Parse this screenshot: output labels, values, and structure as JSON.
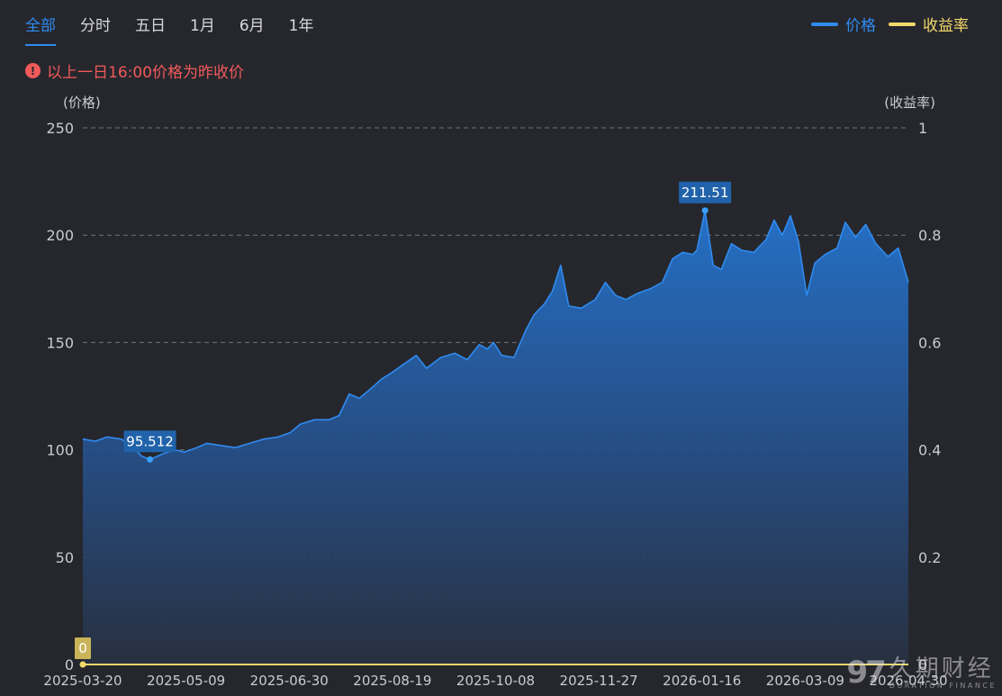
{
  "tabs": [
    {
      "label": "全部",
      "active": true
    },
    {
      "label": "分时",
      "active": false
    },
    {
      "label": "五日",
      "active": false
    },
    {
      "label": "1月",
      "active": false
    },
    {
      "label": "6月",
      "active": false
    },
    {
      "label": "1年",
      "active": false
    }
  ],
  "legend": [
    {
      "label": "价格",
      "color": "#2f8bf0"
    },
    {
      "label": "收益率",
      "color": "#f2d96b"
    }
  ],
  "notice": {
    "icon": "info-icon",
    "text": "以上一日16:00价格为昨收价"
  },
  "watermark": {
    "logo": "97",
    "cn": "久期财经",
    "en": "DURATION FINANCE"
  },
  "chart_data": {
    "type": "area",
    "left_axis_label": "(价格)",
    "right_axis_label": "(收益率)",
    "ylim_left": [
      0,
      250
    ],
    "ylim_right": [
      0,
      1
    ],
    "yticks_left": [
      0,
      50,
      100,
      150,
      200,
      250
    ],
    "yticks_right": [
      "0",
      "0.2",
      "0.4",
      "0.6",
      "0.8",
      "1"
    ],
    "grid": true,
    "x_range": [
      "2025-03-20",
      "2026-04-30"
    ],
    "x_tick_labels": [
      "2025-03-20",
      "2025-05-09",
      "2025-06-30",
      "2025-08-19",
      "2025-10-08",
      "2025-11-27",
      "2026-01-16",
      "2026-03-09",
      "2026-04-30"
    ],
    "series": [
      {
        "name": "价格",
        "axis": "left",
        "color": "#2f8bf0",
        "points": [
          [
            "2025-03-20",
            105
          ],
          [
            "2025-03-26",
            104
          ],
          [
            "2025-04-01",
            106
          ],
          [
            "2025-04-08",
            105
          ],
          [
            "2025-04-14",
            101
          ],
          [
            "2025-04-18",
            97
          ],
          [
            "2025-04-22",
            95.512
          ],
          [
            "2025-04-28",
            98
          ],
          [
            "2025-05-04",
            100
          ],
          [
            "2025-05-09",
            99
          ],
          [
            "2025-05-15",
            101
          ],
          [
            "2025-05-20",
            103
          ],
          [
            "2025-05-27",
            102
          ],
          [
            "2025-06-03",
            101
          ],
          [
            "2025-06-10",
            103
          ],
          [
            "2025-06-17",
            105
          ],
          [
            "2025-06-24",
            106
          ],
          [
            "2025-06-30",
            108
          ],
          [
            "2025-07-05",
            112
          ],
          [
            "2025-07-12",
            114
          ],
          [
            "2025-07-19",
            114
          ],
          [
            "2025-07-24",
            116
          ],
          [
            "2025-07-29",
            126
          ],
          [
            "2025-08-03",
            124
          ],
          [
            "2025-08-08",
            128
          ],
          [
            "2025-08-14",
            133
          ],
          [
            "2025-08-19",
            136
          ],
          [
            "2025-08-25",
            140
          ],
          [
            "2025-08-31",
            144
          ],
          [
            "2025-09-05",
            138
          ],
          [
            "2025-09-12",
            143
          ],
          [
            "2025-09-19",
            145
          ],
          [
            "2025-09-25",
            142
          ],
          [
            "2025-10-01",
            149
          ],
          [
            "2025-10-05",
            147
          ],
          [
            "2025-10-08",
            150
          ],
          [
            "2025-10-12",
            144
          ],
          [
            "2025-10-18",
            143
          ],
          [
            "2025-10-24",
            156
          ],
          [
            "2025-10-28",
            163
          ],
          [
            "2025-11-02",
            168
          ],
          [
            "2025-11-06",
            174
          ],
          [
            "2025-11-10",
            186
          ],
          [
            "2025-11-14",
            167
          ],
          [
            "2025-11-20",
            166
          ],
          [
            "2025-11-27",
            170
          ],
          [
            "2025-12-02",
            178
          ],
          [
            "2025-12-07",
            172
          ],
          [
            "2025-12-12",
            170
          ],
          [
            "2025-12-18",
            173
          ],
          [
            "2025-12-24",
            175
          ],
          [
            "2025-12-30",
            178
          ],
          [
            "2026-01-04",
            189
          ],
          [
            "2026-01-09",
            192
          ],
          [
            "2026-01-14",
            191
          ],
          [
            "2026-01-16",
            193
          ],
          [
            "2026-01-20",
            211.51
          ],
          [
            "2026-01-24",
            186
          ],
          [
            "2026-01-28",
            184
          ],
          [
            "2026-02-02",
            196
          ],
          [
            "2026-02-07",
            193
          ],
          [
            "2026-02-13",
            192
          ],
          [
            "2026-02-19",
            198
          ],
          [
            "2026-02-23",
            207
          ],
          [
            "2026-02-27",
            200
          ],
          [
            "2026-03-03",
            209
          ],
          [
            "2026-03-07",
            197
          ],
          [
            "2026-03-11",
            172
          ],
          [
            "2026-03-15",
            187
          ],
          [
            "2026-03-20",
            191
          ],
          [
            "2026-03-26",
            194
          ],
          [
            "2026-03-30",
            206
          ],
          [
            "2026-04-04",
            199
          ],
          [
            "2026-04-09",
            205
          ],
          [
            "2026-04-14",
            196
          ],
          [
            "2026-04-20",
            190
          ],
          [
            "2026-04-25",
            194
          ],
          [
            "2026-04-30",
            178
          ]
        ]
      },
      {
        "name": "收益率",
        "axis": "right",
        "color": "#f2d96b",
        "points": [
          [
            "2025-03-20",
            0
          ],
          [
            "2026-04-30",
            0
          ]
        ]
      }
    ],
    "annotations": [
      {
        "label": "95.512",
        "x": "2025-04-22",
        "y": 95.512,
        "series": "价格"
      },
      {
        "label": "211.51",
        "x": "2026-01-20",
        "y": 211.51,
        "series": "价格"
      },
      {
        "label": "0",
        "x": "2025-03-20",
        "y": 0,
        "series": "收益率"
      }
    ]
  }
}
